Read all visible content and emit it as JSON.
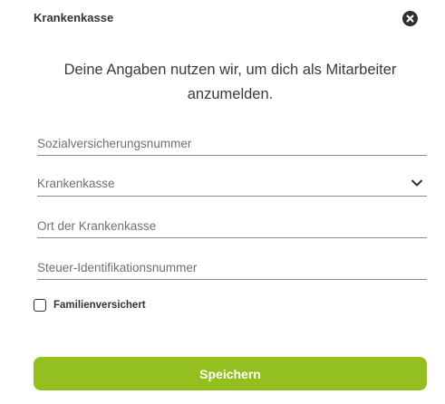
{
  "dialog": {
    "title": "Krankenkasse",
    "close_icon": "close-circle-icon",
    "intro_text": "Deine Angaben nutzen wir, um dich als Mitarbeiter anzumelden."
  },
  "form": {
    "social_security": {
      "placeholder": "Sozialversicherungsnummer",
      "value": ""
    },
    "insurance": {
      "selected": "Krankenkasse",
      "icon": "chevron-down-icon"
    },
    "insurance_location": {
      "placeholder": "Ort der Krankenkasse",
      "value": ""
    },
    "tax_id": {
      "placeholder": "Steuer-Identifikationsnummer",
      "value": ""
    },
    "family_insured": {
      "label": "Familienversichert",
      "checked": false
    }
  },
  "actions": {
    "save_label": "Speichern"
  },
  "colors": {
    "accent": "#93c01f",
    "close_button": "#2f2f2f",
    "underline": "#8c8c8c"
  }
}
